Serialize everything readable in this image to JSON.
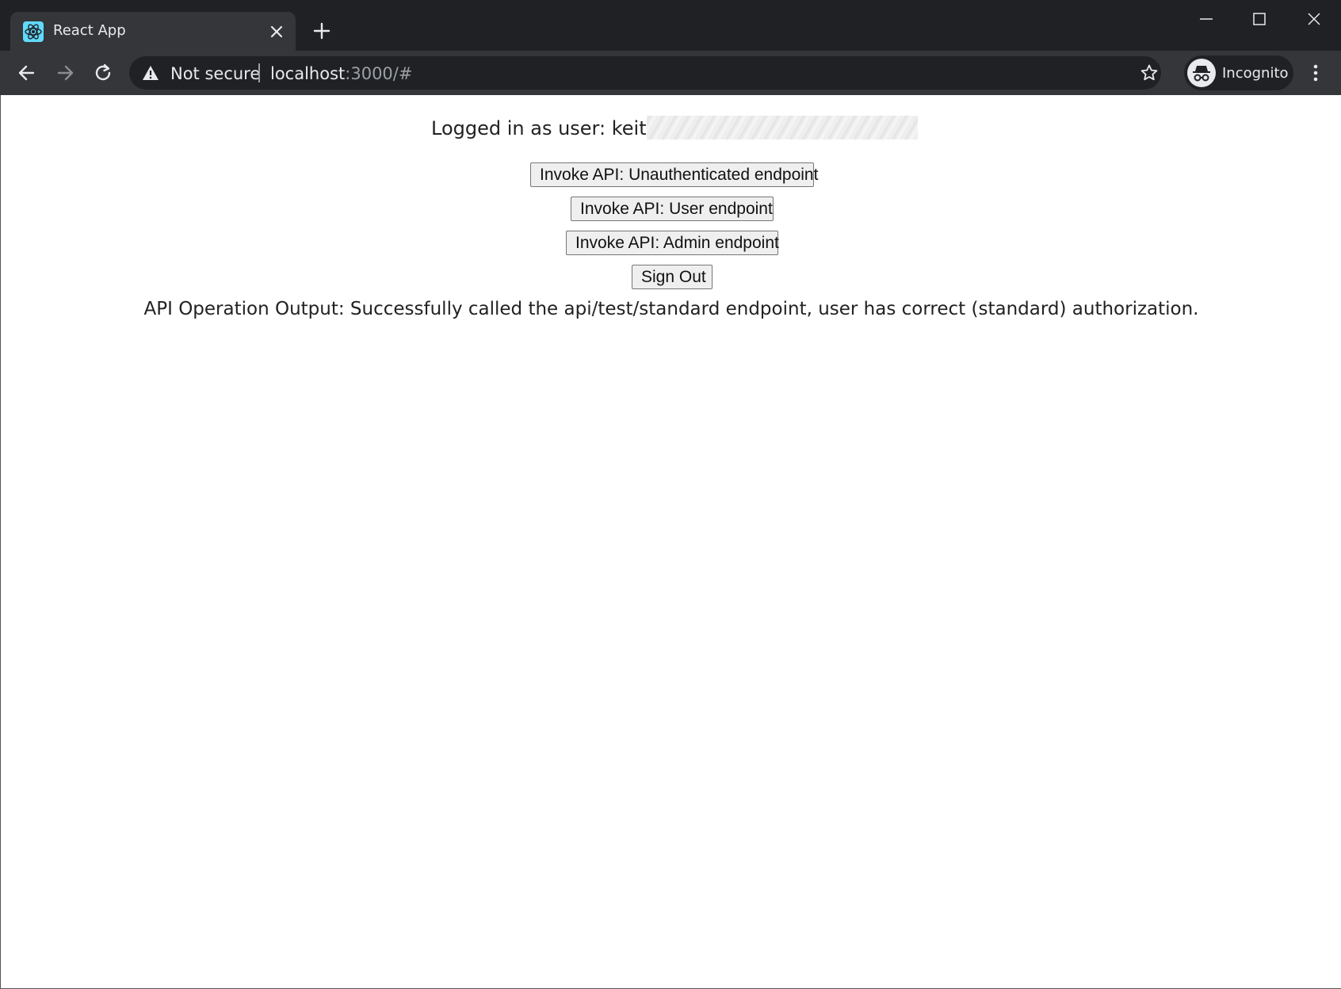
{
  "browser": {
    "tab_title": "React App",
    "security_label": "Not secure",
    "url_host": "localhost",
    "url_rest": ":3000/#",
    "profile_label": "Incognito"
  },
  "page": {
    "logged_in_text": "Logged in as user: keith@",
    "buttons": {
      "unauthenticated": "Invoke API: Unauthenticated endpoint",
      "user": "Invoke API: User endpoint",
      "admin": "Invoke API: Admin endpoint",
      "sign_out": "Sign Out"
    },
    "api_output": "API Operation Output: Successfully called the api/test/standard endpoint, user has correct (standard) authorization."
  },
  "icons": {
    "favicon": "react-logo-icon",
    "tab_close": "close-icon",
    "new_tab": "plus-icon",
    "back": "arrow-left-icon",
    "forward": "arrow-right-icon",
    "reload": "reload-icon",
    "warning": "warning-icon",
    "bookmark": "star-icon",
    "incognito": "incognito-icon",
    "menu": "kebab-menu-icon"
  },
  "colors": {
    "chrome_bg": "#202124",
    "toolbar_bg": "#35363a",
    "react_cyan": "#61dafb"
  }
}
